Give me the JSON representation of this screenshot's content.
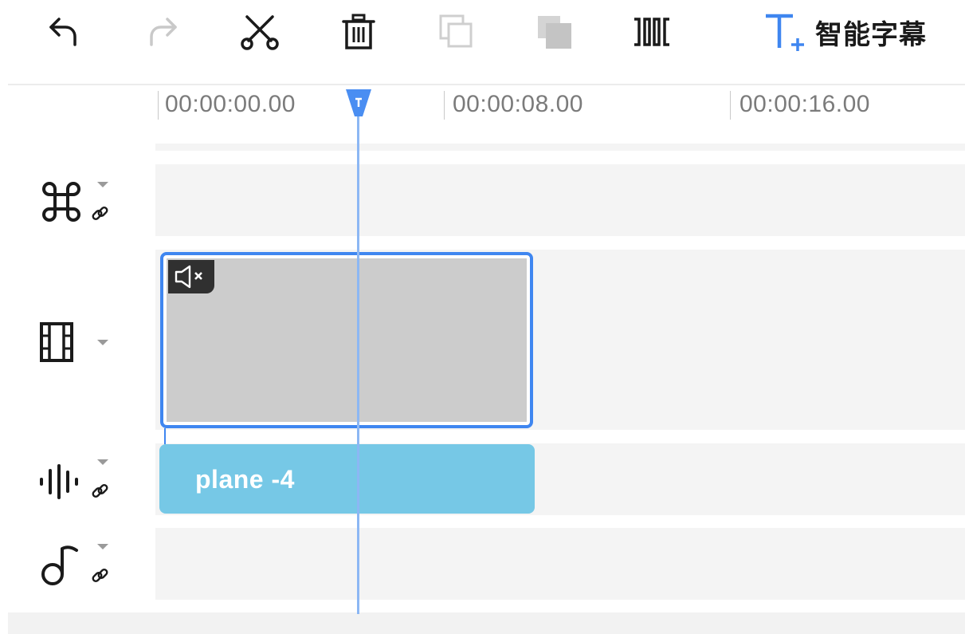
{
  "toolbar": {
    "buttons": [
      {
        "name": "undo-icon",
        "enabled": true
      },
      {
        "name": "redo-icon",
        "enabled": false
      },
      {
        "name": "scissors-icon",
        "enabled": true
      },
      {
        "name": "trash-icon",
        "enabled": true
      },
      {
        "name": "copy-icon",
        "enabled": false
      },
      {
        "name": "paste-icon",
        "enabled": false
      },
      {
        "name": "split-icon",
        "enabled": true
      }
    ],
    "smart_subtitle": {
      "icon": "text-add-icon",
      "label": "智能字幕"
    }
  },
  "ruler": {
    "ticks": [
      "00:00:00.00",
      "00:00:08.00",
      "00:00:16.00"
    ]
  },
  "tracks": [
    {
      "type": "effects",
      "icon": "command-icon",
      "has_link": true,
      "clips": []
    },
    {
      "type": "video",
      "icon": "film-icon",
      "has_link": false,
      "clips": [
        {
          "muted": true,
          "selected": true
        }
      ]
    },
    {
      "type": "audio",
      "icon": "waveform-icon",
      "has_link": true,
      "clips": [
        {
          "label": "plane -4"
        }
      ]
    },
    {
      "type": "music",
      "icon": "music-note-icon",
      "has_link": true,
      "clips": []
    }
  ],
  "colors": {
    "accent": "#3f86f0",
    "audio_clip": "#76c8e6",
    "video_clip_fill": "#cccccc",
    "playhead": "#8cb7f4",
    "lane_bg": "#f4f4f4"
  }
}
